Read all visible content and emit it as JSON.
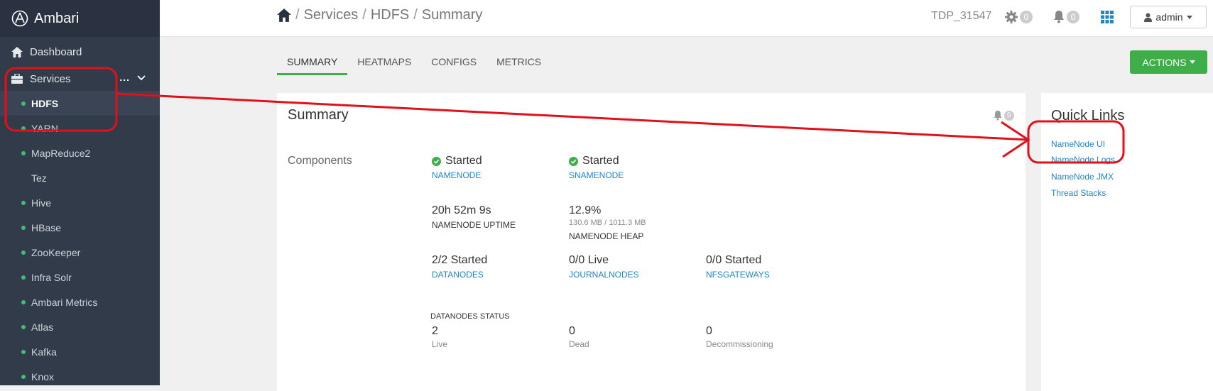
{
  "brand": {
    "name": "Ambari"
  },
  "sidebar": {
    "dashboard_label": "Dashboard",
    "services_label": "Services",
    "services_more": "...",
    "items": [
      {
        "label": "HDFS",
        "active": true,
        "dot": true
      },
      {
        "label": "YARN",
        "active": false,
        "dot": true
      },
      {
        "label": "MapReduce2",
        "active": false,
        "dot": true
      },
      {
        "label": "Tez",
        "active": false,
        "dot": false
      },
      {
        "label": "Hive",
        "active": false,
        "dot": true
      },
      {
        "label": "HBase",
        "active": false,
        "dot": true
      },
      {
        "label": "ZooKeeper",
        "active": false,
        "dot": true
      },
      {
        "label": "Infra Solr",
        "active": false,
        "dot": true
      },
      {
        "label": "Ambari Metrics",
        "active": false,
        "dot": true
      },
      {
        "label": "Atlas",
        "active": false,
        "dot": true
      },
      {
        "label": "Kafka",
        "active": false,
        "dot": true
      },
      {
        "label": "Knox",
        "active": false,
        "dot": true
      }
    ]
  },
  "header": {
    "breadcrumb": [
      "Services",
      "HDFS",
      "Summary"
    ],
    "separator": "/",
    "cluster": "TDP_31547",
    "ops_count": "0",
    "alerts_count": "0",
    "user": "admin"
  },
  "tabs": [
    "SUMMARY",
    "HEATMAPS",
    "CONFIGS",
    "METRICS"
  ],
  "actions_label": "ACTIONS",
  "summary": {
    "title": "Summary",
    "alerts_count": "0",
    "components_label": "Components",
    "namenode": {
      "value": "Started",
      "link": "NAMENODE"
    },
    "snamenode": {
      "value": "Started",
      "link": "SNAMENODE"
    },
    "uptime": {
      "value": "20h 52m 9s",
      "label": "NAMENODE UPTIME"
    },
    "heap": {
      "value": "12.9%",
      "sub": "130.6 MB / 1011.3 MB",
      "label": "NAMENODE HEAP"
    },
    "datanodes": {
      "value": "2/2 Started",
      "link": "DATANODES"
    },
    "journalnodes": {
      "value": "0/0 Live",
      "link": "JOURNALNODES"
    },
    "nfsgateways": {
      "value": "0/0 Started",
      "link": "NFSGATEWAYS"
    },
    "datanodes_status_label": "DATANODES STATUS",
    "live": {
      "value": "2",
      "label": "Live"
    },
    "dead": {
      "value": "0",
      "label": "Dead"
    },
    "decommissioning": {
      "value": "0",
      "label": "Decommissioning"
    }
  },
  "quick_links": {
    "title": "Quick Links",
    "links": [
      "NameNode UI",
      "NameNode Logs",
      "NameNode JMX",
      "Thread Stacks"
    ]
  },
  "colors": {
    "sidebar": "#323b4a",
    "accent_green": "#3fae49",
    "link_blue": "#1f86c8",
    "annotation_red": "#e0111b"
  }
}
